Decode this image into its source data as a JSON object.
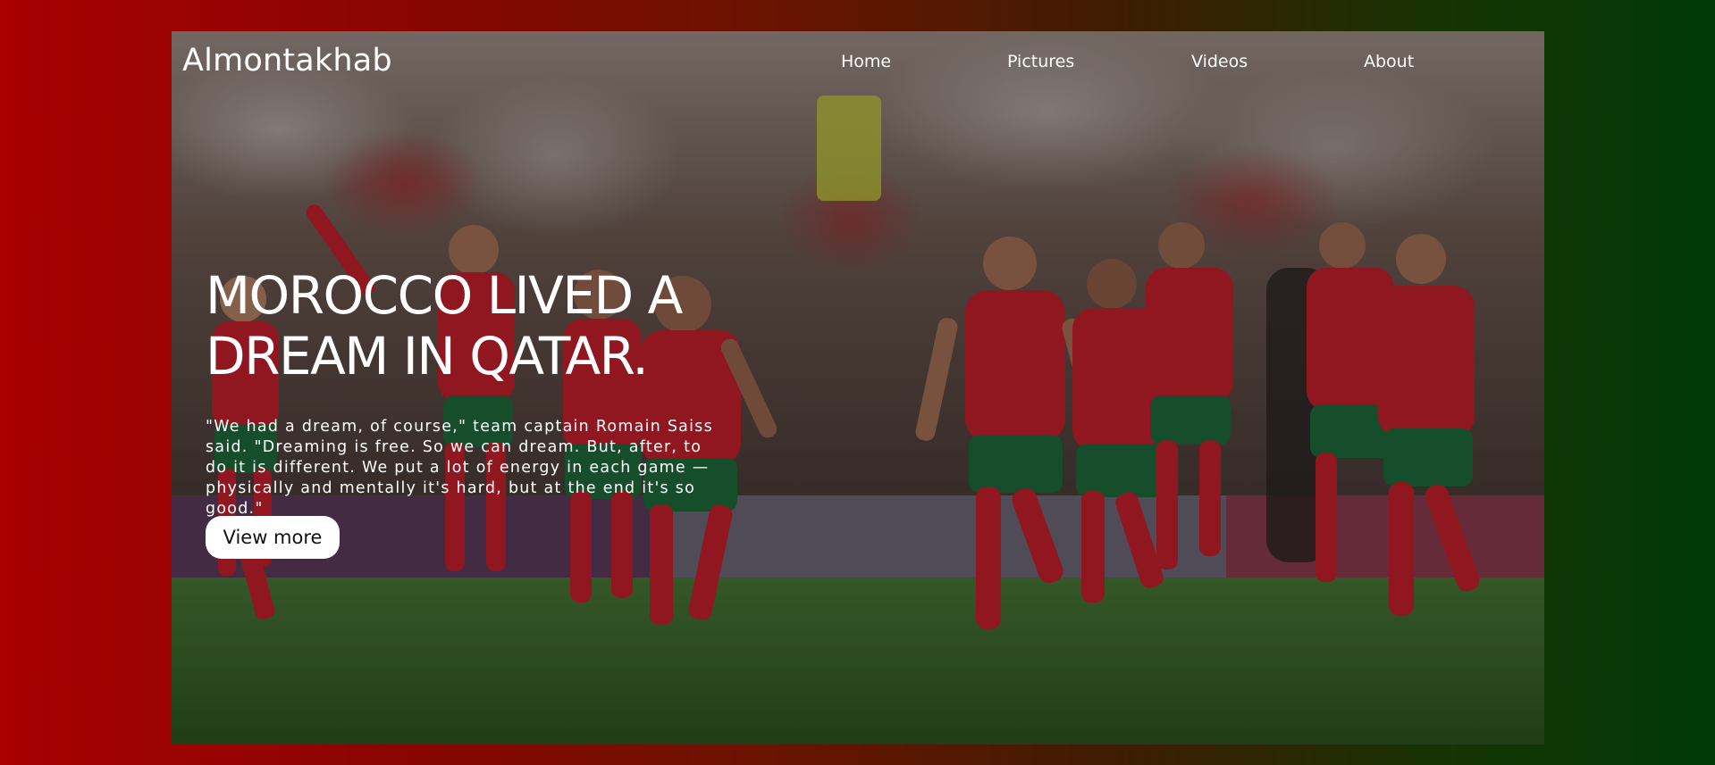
{
  "brand": {
    "name": "Almontakhab"
  },
  "nav": {
    "items": [
      {
        "label": "Home"
      },
      {
        "label": "Pictures"
      },
      {
        "label": "Videos"
      },
      {
        "label": "About"
      }
    ]
  },
  "hero": {
    "headline": "MOROCCO LIVED A DREAM IN QATAR.",
    "quote": "\"We had a dream, of course,\" team captain Romain Saiss said. \"Dreaming is free. So we can dream. But, after, to do it is different. We put a lot of energy in each game — physically and mentally it's hard, but at the end it's so good.\"",
    "cta_label": "View more",
    "background_image": "morocco-team-celebration-photo"
  },
  "colors": {
    "gradient_left": "#a80003",
    "gradient_middle": "#6a1402",
    "gradient_right": "#003a06",
    "jersey_red": "#c8202b",
    "jersey_green": "#1f6b3b",
    "pitch_green": "#2f5f23",
    "button_bg": "#ffffff",
    "text": "#ffffff"
  }
}
